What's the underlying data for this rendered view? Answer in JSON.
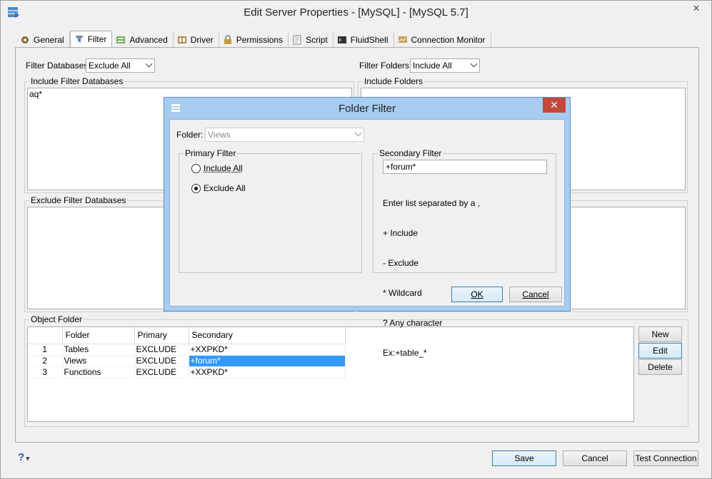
{
  "window": {
    "title": "Edit Server Properties - [MySQL] - [MySQL 5.7]"
  },
  "tabs": [
    {
      "label": "General",
      "icon": "gear-icon"
    },
    {
      "label": "Filter",
      "icon": "filter-icon"
    },
    {
      "label": "Advanced",
      "icon": "advanced-icon"
    },
    {
      "label": "Driver",
      "icon": "driver-icon"
    },
    {
      "label": "Permissions",
      "icon": "permissions-icon"
    },
    {
      "label": "Script",
      "icon": "script-icon"
    },
    {
      "label": "FluidShell",
      "icon": "shell-icon"
    },
    {
      "label": "Connection Monitor",
      "icon": "monitor-icon"
    }
  ],
  "filter": {
    "databases_label": "Filter Databases",
    "databases_value": "Exclude All",
    "folders_label": "Filter Folders:",
    "folders_value": "Include All",
    "include_db_title": "Include Filter Databases",
    "include_db_text": "aq*",
    "include_folders_title": "Include Folders",
    "exclude_db_title": "Exclude Filter Databases"
  },
  "object_folder": {
    "title": "Object Folder",
    "columns": [
      "Folder",
      "Primary",
      "Secondary"
    ],
    "rows": [
      {
        "num": "1",
        "folder": "Tables",
        "primary": "EXCLUDE",
        "secondary": "+XXPKD*"
      },
      {
        "num": "2",
        "folder": "Views",
        "primary": "EXCLUDE",
        "secondary": "+forum*"
      },
      {
        "num": "3",
        "folder": "Functions",
        "primary": "EXCLUDE",
        "secondary": "+XXPKD*"
      }
    ],
    "buttons": {
      "new": "New",
      "edit": "Edit",
      "delete": "Delete"
    }
  },
  "footer": {
    "help": "?",
    "save": "Save",
    "cancel": "Cancel",
    "test": "Test Connection"
  },
  "dialog": {
    "title": "Folder Filter",
    "folder_label": "Folder:",
    "folder_value": "Views",
    "primary_title": "Primary Filter",
    "include_all": "Include All",
    "exclude_all": "Exclude All",
    "secondary_title": "Secondary Filter",
    "secondary_value": "+forum*",
    "help_lines": [
      "Enter list separated by a ,",
      "+ Include",
      "- Exclude",
      "* Wildcard",
      "? Any character",
      "Ex:+table_*"
    ],
    "ok": "OK",
    "cancel": "Cancel"
  }
}
